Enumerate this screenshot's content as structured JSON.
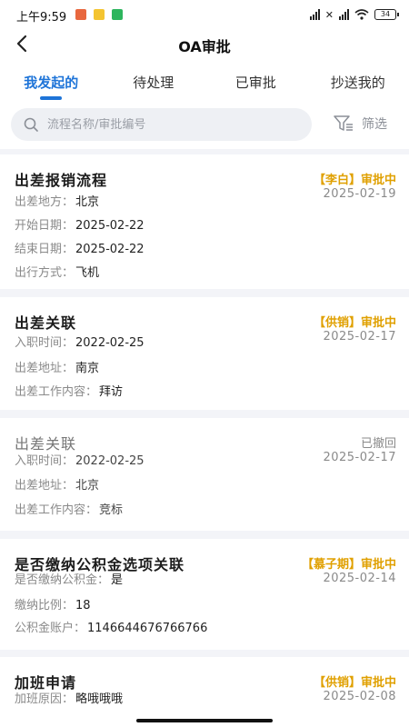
{
  "status_bar": {
    "time": "上午9:59",
    "battery": "34"
  },
  "nav": {
    "title": "OA审批"
  },
  "tabs": [
    {
      "label": "我发起的",
      "active": true
    },
    {
      "label": "待处理",
      "active": false
    },
    {
      "label": "已审批",
      "active": false
    },
    {
      "label": "抄送我的",
      "active": false
    }
  ],
  "search": {
    "placeholder": "流程名称/审批编号",
    "filter_label": "筛选"
  },
  "colors": {
    "accent": "#1e74d8",
    "pending": "#e0a000",
    "withdrawn": "#8a8a8a"
  },
  "cards": [
    {
      "title": "出差报销流程",
      "status": "【李白】审批中",
      "date": "2025-02-19",
      "fields": [
        {
          "label": "出差地方：",
          "value": "北京"
        },
        {
          "label": "开始日期：",
          "value": "2025-02-22"
        },
        {
          "label": "结束日期：",
          "value": "2025-02-22"
        },
        {
          "label": "出行方式：",
          "value": "飞机"
        }
      ]
    },
    {
      "title": "出差关联",
      "status": "【供销】审批中",
      "date": "2025-02-17",
      "fields": [
        {
          "label": "入职时间：",
          "value": "2022-02-25"
        },
        {
          "label": "出差地址：",
          "value": "南京"
        },
        {
          "label": "出差工作内容：",
          "value": "拜访"
        }
      ]
    },
    {
      "title": "出差关联",
      "status": "已撤回",
      "date": "2025-02-17",
      "fields": [
        {
          "label": "入职时间：",
          "value": "2022-02-25"
        },
        {
          "label": "出差地址：",
          "value": "北京"
        },
        {
          "label": "出差工作内容：",
          "value": "竞标"
        }
      ]
    },
    {
      "title": "是否缴纳公积金选项关联",
      "status": "【慕子期】审批中",
      "date": "2025-02-14",
      "fields": [
        {
          "label": "是否缴纳公积金：",
          "value": "是"
        },
        {
          "label": "缴纳比例：",
          "value": "18"
        },
        {
          "label": "公积金账户：",
          "value": "1146644676766766"
        }
      ]
    },
    {
      "title": "加班申请",
      "status": "【供销】审批中",
      "date": "2025-02-08",
      "fields": [
        {
          "label": "加班原因：",
          "value": "略哦哦哦"
        }
      ]
    }
  ]
}
